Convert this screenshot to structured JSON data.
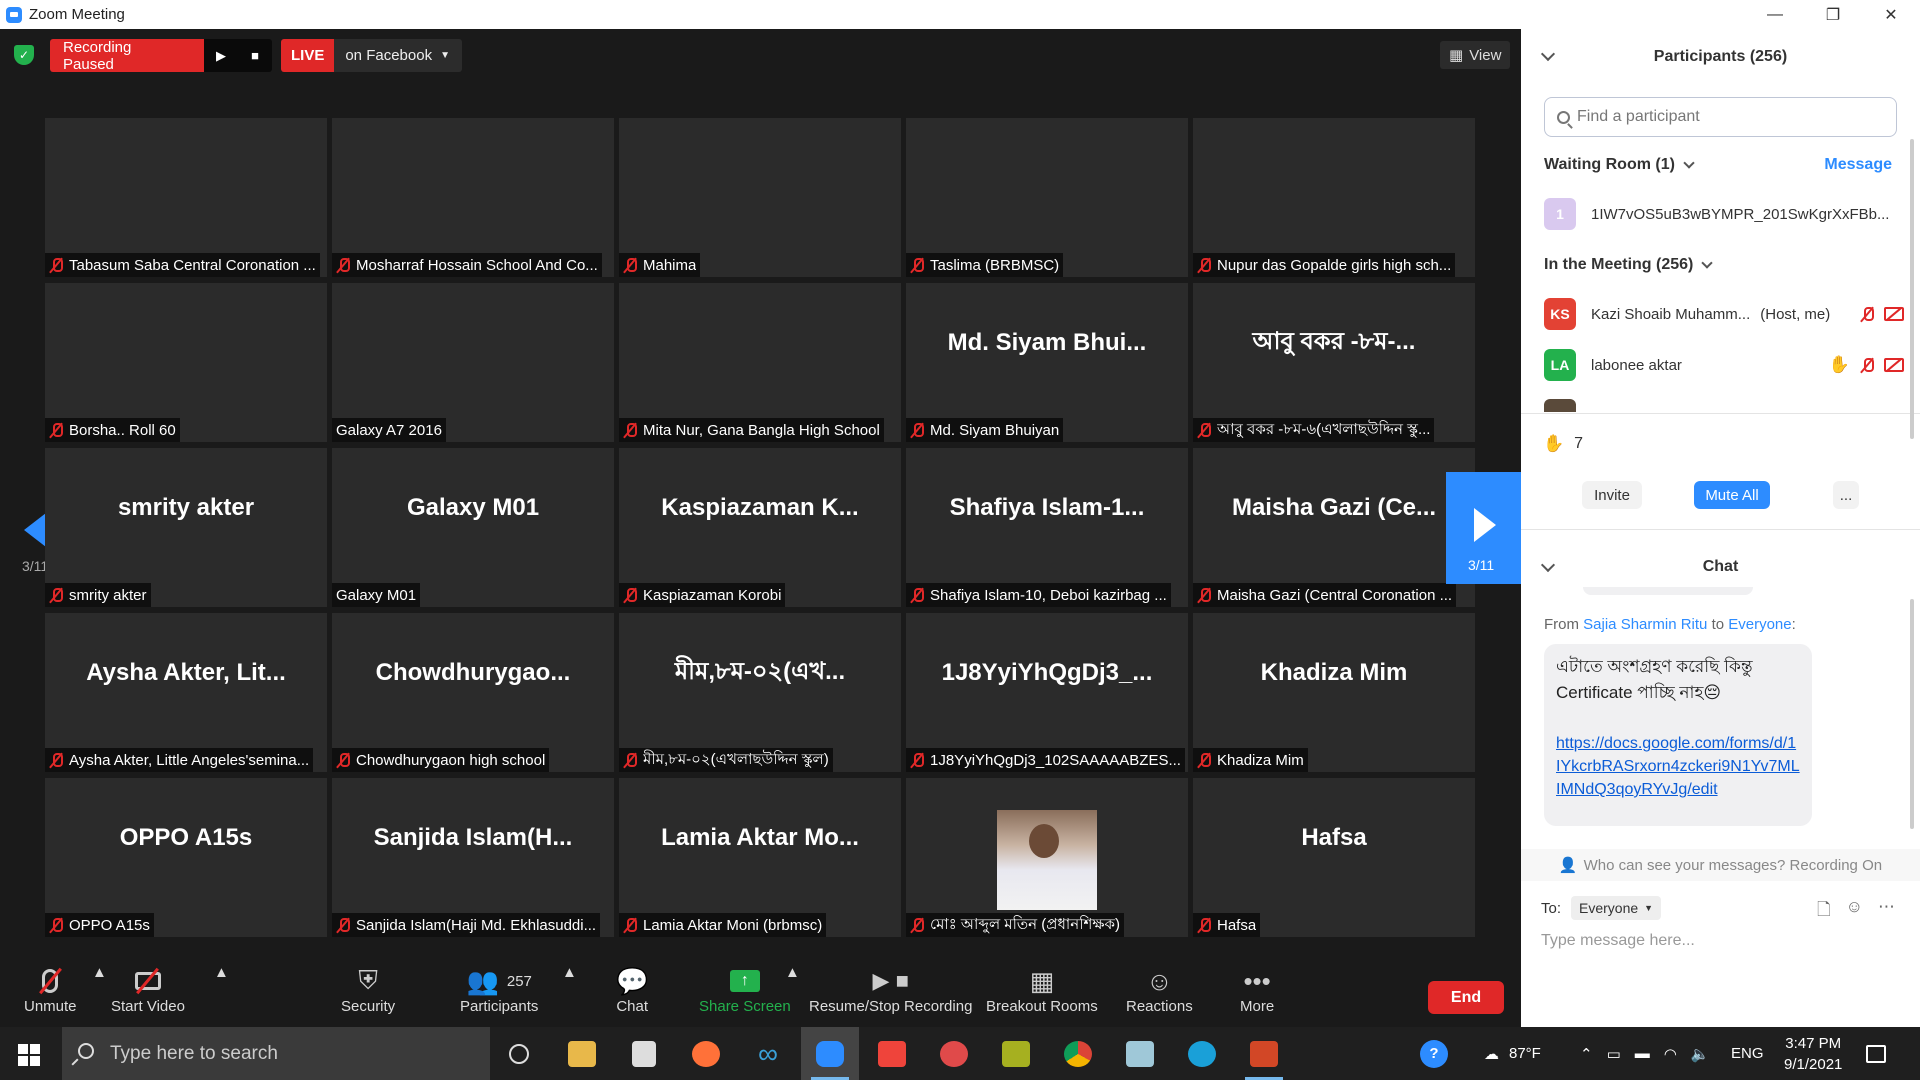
{
  "window": {
    "title": "Zoom Meeting"
  },
  "topbar": {
    "recording_status": "Recording Paused",
    "live_label": "LIVE",
    "live_target": "on Facebook",
    "view_label": "View"
  },
  "page_indicator": "3/11",
  "tiles": [
    {
      "big": "",
      "label": "Tabasum Saba Central Coronation ...",
      "muted": true
    },
    {
      "big": "",
      "label": "Mosharraf Hossain School And Co...",
      "muted": true
    },
    {
      "big": "",
      "label": "Mahima",
      "muted": true
    },
    {
      "big": "",
      "label": "Taslima (BRBMSC)",
      "muted": true
    },
    {
      "big": "",
      "label": "Nupur das Gopalde girls high sch...",
      "muted": true
    },
    {
      "big": "",
      "label": "Borsha.. Roll 60",
      "muted": true
    },
    {
      "big": "",
      "label": "Galaxy A7 2016",
      "muted": false
    },
    {
      "big": "",
      "label": "Mita Nur, Gana Bangla High School",
      "muted": true
    },
    {
      "big": "Md.  Siyam  Bhui...",
      "label": "Md. Siyam Bhuiyan",
      "muted": true
    },
    {
      "big": "আবু বকর -৮ম-...",
      "label": "আবু বকর -৮ম-৬(এখলাছউদ্দিন স্কু...",
      "muted": true
    },
    {
      "big": "smrity akter",
      "label": "smrity akter",
      "muted": true
    },
    {
      "big": "Galaxy M01",
      "label": "Galaxy M01",
      "muted": false
    },
    {
      "big": "Kaspiazaman  K...",
      "label": "Kaspiazaman Korobi",
      "muted": true
    },
    {
      "big": "Shafiya  Islam-1...",
      "label": "Shafiya Islam-10, Deboi kazirbag ...",
      "muted": true
    },
    {
      "big": "Maisha  Gazi  (Ce...",
      "label": "Maisha Gazi (Central Coronation ...",
      "muted": true
    },
    {
      "big": "Aysha  Akter,  Lit...",
      "label": "Aysha Akter, Little Angeles'semina...",
      "muted": true
    },
    {
      "big": "Chowdhurygao...",
      "label": "Chowdhurygaon high school",
      "muted": true
    },
    {
      "big": "মীম,৮ম-০২(এখ...",
      "label": "মীম,৮ম-০২(এখলাছউদ্দিন স্কুল)",
      "muted": true
    },
    {
      "big": "1J8YyiYhQgDj3_...",
      "label": "1J8YyiYhQgDj3_102SAAAAABZES...",
      "muted": true
    },
    {
      "big": "Khadiza Mim",
      "label": "Khadiza Mim",
      "muted": true
    },
    {
      "big": "OPPO A15s",
      "label": "OPPO A15s",
      "muted": true
    },
    {
      "big": "Sanjida  Islam(H...",
      "label": "Sanjida Islam(Haji Md. Ekhlasuddi...",
      "muted": true
    },
    {
      "big": "Lamia  Aktar  Mo...",
      "label": "Lamia Aktar Moni (brbmsc)",
      "muted": true
    },
    {
      "big": "",
      "label": "মোঃ আব্দুল মতিন (প্রধানশিক্ষক)",
      "muted": true,
      "photo": true
    },
    {
      "big": "Hafsa",
      "label": "Hafsa",
      "muted": true
    }
  ],
  "toolbar": {
    "unmute": "Unmute",
    "start_video": "Start Video",
    "security": "Security",
    "participants": "Participants",
    "participant_count": "257",
    "chat": "Chat",
    "share_screen": "Share Screen",
    "recording": "Resume/Stop Recording",
    "breakout": "Breakout Rooms",
    "reactions": "Reactions",
    "more": "More",
    "end": "End"
  },
  "panel": {
    "participants_title": "Participants (256)",
    "search_placeholder": "Find a participant",
    "waiting_room": "Waiting Room (1)",
    "message_label": "Message",
    "waiting_user": "1IW7vOS5uB3wBYMPR_201SwKgrXxFBb...",
    "waiting_avatar": "1",
    "in_meeting": "In the Meeting (256)",
    "people": [
      {
        "initials": "KS",
        "name": "Kazi Shoaib Muhamm...",
        "tag": "(Host, me)",
        "color": "#e34234"
      },
      {
        "initials": "LA",
        "name": "labonee aktar",
        "tag": "",
        "color": "#23b14d"
      }
    ],
    "hand_count": "7",
    "invite": "Invite",
    "mute_all": "Mute All",
    "more": "...",
    "chat_title": "Chat",
    "chat_from_prefix": "From",
    "chat_sender": "Sajia Sharmin Ritu",
    "chat_to_word": "to",
    "chat_recipient": "Everyone",
    "chat_message": "এটাতে অংশগ্রহণ করেছি কিন্তু Certificate পাচ্ছি নাহ😔",
    "chat_link": "https://docs.google.com/forms/d/1IYkcrbRASrxorn4zckeri9N1Yv7MLIMNdQ3qoyRYvJg/edit",
    "who_can_see": "Who can see your messages? Recording On",
    "to_label": "To:",
    "to_value": "Everyone",
    "type_placeholder": "Type message here..."
  },
  "taskbar": {
    "search_placeholder": "Type here to search",
    "weather": "87°F",
    "lang": "ENG",
    "time": "3:47 PM",
    "date": "9/1/2021"
  },
  "colors": {
    "accent": "#2d8cff",
    "danger": "#e02828",
    "share": "#23b14d"
  }
}
